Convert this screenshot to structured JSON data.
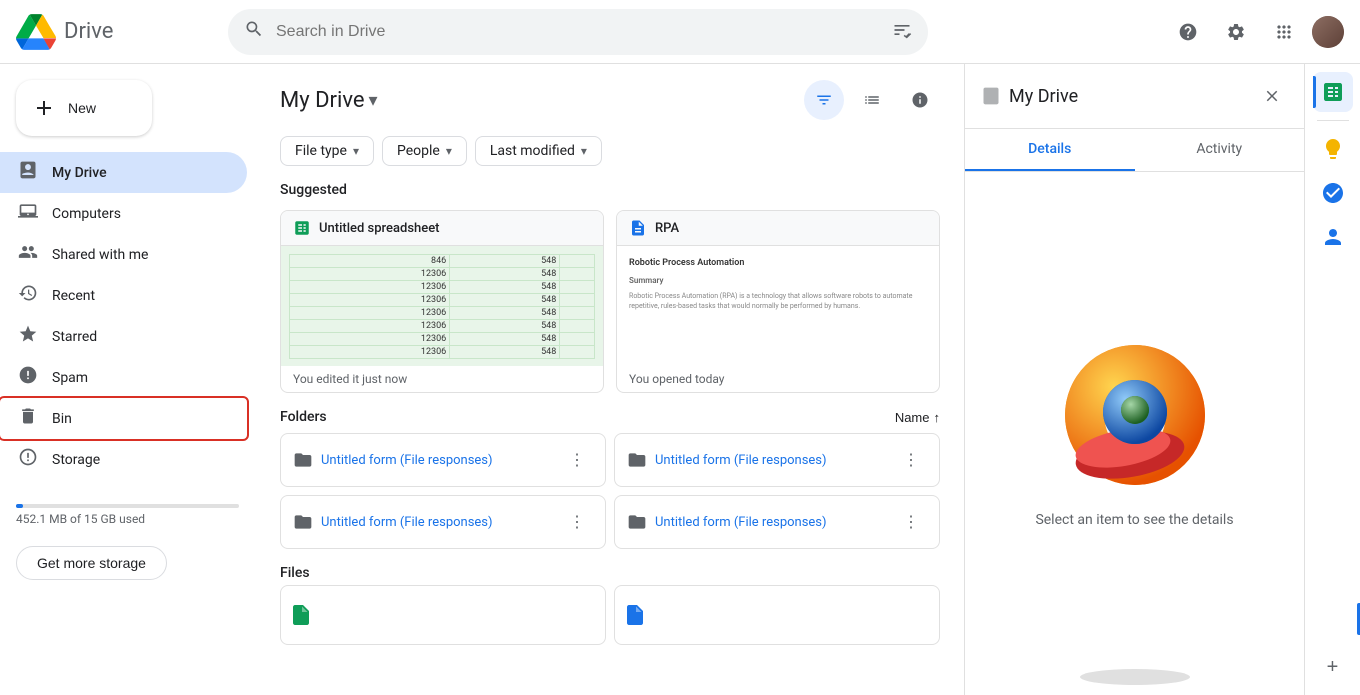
{
  "app": {
    "title": "Drive",
    "logo_alt": "Google Drive"
  },
  "header": {
    "search_placeholder": "Search in Drive",
    "help_icon": "?",
    "settings_icon": "⚙",
    "apps_icon": "⋮⋮⋮"
  },
  "sidebar": {
    "new_button": "New",
    "nav_items": [
      {
        "id": "my-drive",
        "label": "My Drive",
        "icon": "🗂",
        "active": true
      },
      {
        "id": "computers",
        "label": "Computers",
        "icon": "💻",
        "active": false
      },
      {
        "id": "shared-with-me",
        "label": "Shared with me",
        "icon": "👤",
        "active": false
      },
      {
        "id": "recent",
        "label": "Recent",
        "icon": "🕐",
        "active": false
      },
      {
        "id": "starred",
        "label": "Starred",
        "icon": "⭐",
        "active": false
      },
      {
        "id": "spam",
        "label": "Spam",
        "icon": "⚠",
        "active": false
      },
      {
        "id": "bin",
        "label": "Bin",
        "icon": "🗑",
        "active": false,
        "selected": true
      }
    ],
    "storage_label": "Storage",
    "storage_used": "452.1 MB of 15 GB used",
    "storage_percent": 3,
    "get_more_storage": "Get more storage"
  },
  "main": {
    "title": "My Drive",
    "title_arrow": "▾",
    "filter_chips": [
      {
        "id": "file-type",
        "label": "File type",
        "arrow": "▾"
      },
      {
        "id": "people",
        "label": "People",
        "arrow": "▾"
      },
      {
        "id": "last-modified",
        "label": "Last modified",
        "arrow": "▾"
      }
    ],
    "suggested_section": "Suggested",
    "suggested_items": [
      {
        "id": "untitled-spreadsheet",
        "title": "Untitled spreadsheet",
        "icon_type": "spreadsheet",
        "footer": "You edited it just now"
      },
      {
        "id": "rpa-doc",
        "title": "RPA",
        "icon_type": "document",
        "footer": "You opened today"
      }
    ],
    "folders_section": "Folders",
    "sort_label": "Name",
    "sort_arrow": "↑",
    "folders": [
      {
        "id": "folder-1",
        "name": "Untitled form (File responses)"
      },
      {
        "id": "folder-2",
        "name": "Untitled form (File responses)"
      },
      {
        "id": "folder-3",
        "name": "Untitled form (File responses)"
      },
      {
        "id": "folder-4",
        "name": "Untitled form (File responses)"
      }
    ],
    "files_section": "Files"
  },
  "right_panel": {
    "title": "My Drive",
    "close_icon": "✕",
    "tabs": [
      {
        "id": "details",
        "label": "Details",
        "active": true
      },
      {
        "id": "activity",
        "label": "Activity",
        "active": false
      }
    ],
    "select_text": "Select an item to see the details"
  },
  "right_sidebar": {
    "apps": [
      {
        "id": "sheets",
        "color": "#0f9d58",
        "active": true
      },
      {
        "id": "keep",
        "color": "#f4b400"
      },
      {
        "id": "tasks",
        "color": "#1a73e8"
      },
      {
        "id": "contacts",
        "color": "#1a73e8"
      }
    ]
  }
}
